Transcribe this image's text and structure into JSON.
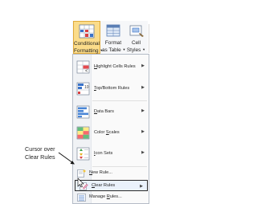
{
  "ribbon": {
    "conditional_formatting": {
      "line1": "Conditional",
      "line2": "Formatting"
    },
    "format_as_table": {
      "line1": "Format",
      "line2": "as Table"
    },
    "cell_styles": {
      "line1": "Cell",
      "line2": "Styles"
    }
  },
  "menu": {
    "items": [
      {
        "label_pre": "",
        "label_key": "H",
        "label_post": "ighlight Cells Rules",
        "icon": "highlight-cells-icon"
      },
      {
        "label_pre": "",
        "label_key": "T",
        "label_post": "op/Bottom Rules",
        "icon": "top-bottom-icon"
      },
      {
        "label_pre": "",
        "label_key": "D",
        "label_post": "ata Bars",
        "icon": "data-bars-icon"
      },
      {
        "label_pre": "Color ",
        "label_key": "S",
        "label_post": "cales",
        "icon": "color-scales-icon"
      },
      {
        "label_pre": "",
        "label_key": "I",
        "label_post": "con Sets",
        "icon": "icon-sets-icon"
      },
      {
        "label_pre": "",
        "label_key": "N",
        "label_post": "ew Rule...",
        "icon": "new-rule-icon"
      },
      {
        "label_pre": "",
        "label_key": "C",
        "label_post": "lear Rules",
        "icon": "clear-rules-icon"
      },
      {
        "label_pre": "Manage ",
        "label_key": "R",
        "label_post": "ules...",
        "icon": "manage-rules-icon"
      }
    ]
  },
  "annotation": {
    "line1": "Cursor over",
    "line2": "Clear Rules"
  },
  "colors": {
    "accent": "#fbdc8a",
    "highlight_border": "#2a2a2a"
  }
}
